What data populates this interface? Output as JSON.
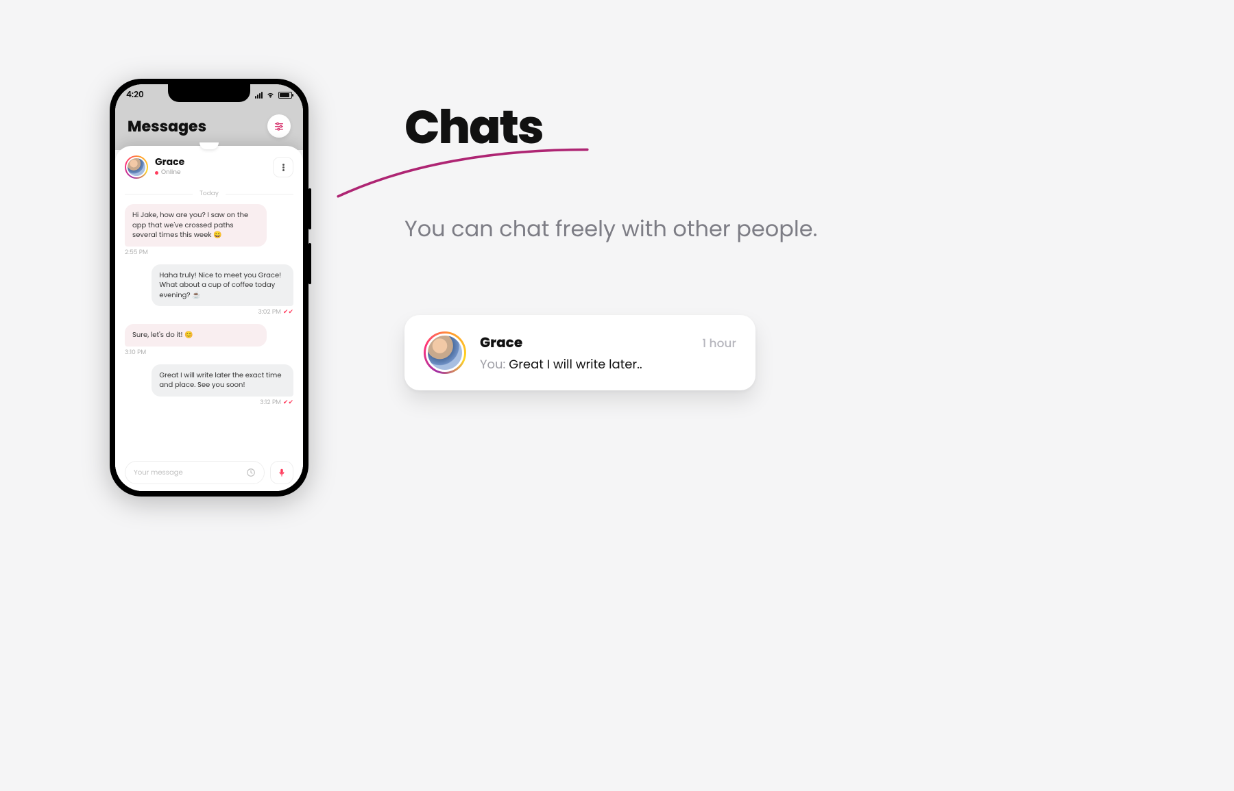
{
  "page": {
    "headline": "Chats",
    "description": "You can chat freely with other people."
  },
  "phone": {
    "status": {
      "time": "4:20"
    },
    "header": {
      "title": "Messages"
    },
    "chat": {
      "user": {
        "name": "Grace",
        "status": "Online"
      },
      "day_separator": "Today",
      "composer_placeholder": "Your message",
      "messages": [
        {
          "dir": "in",
          "text": "Hi Jake, how are you? I saw on the app that we've crossed paths several times this week 😄",
          "time": "2:55 PM"
        },
        {
          "dir": "out",
          "text": "Haha truly! Nice to meet you Grace! What about a cup of coffee today evening? ☕",
          "time": "3:02 PM",
          "read": true
        },
        {
          "dir": "in",
          "text": "Sure, let's do it! 😊",
          "time": "3:10 PM"
        },
        {
          "dir": "out",
          "text": "Great I will write later the exact time and place. See you soon!",
          "time": "3:12 PM",
          "read": true
        }
      ]
    }
  },
  "preview_card": {
    "name": "Grace",
    "time": "1 hour",
    "you_prefix": "You: ",
    "message": "Great I will write later.."
  }
}
